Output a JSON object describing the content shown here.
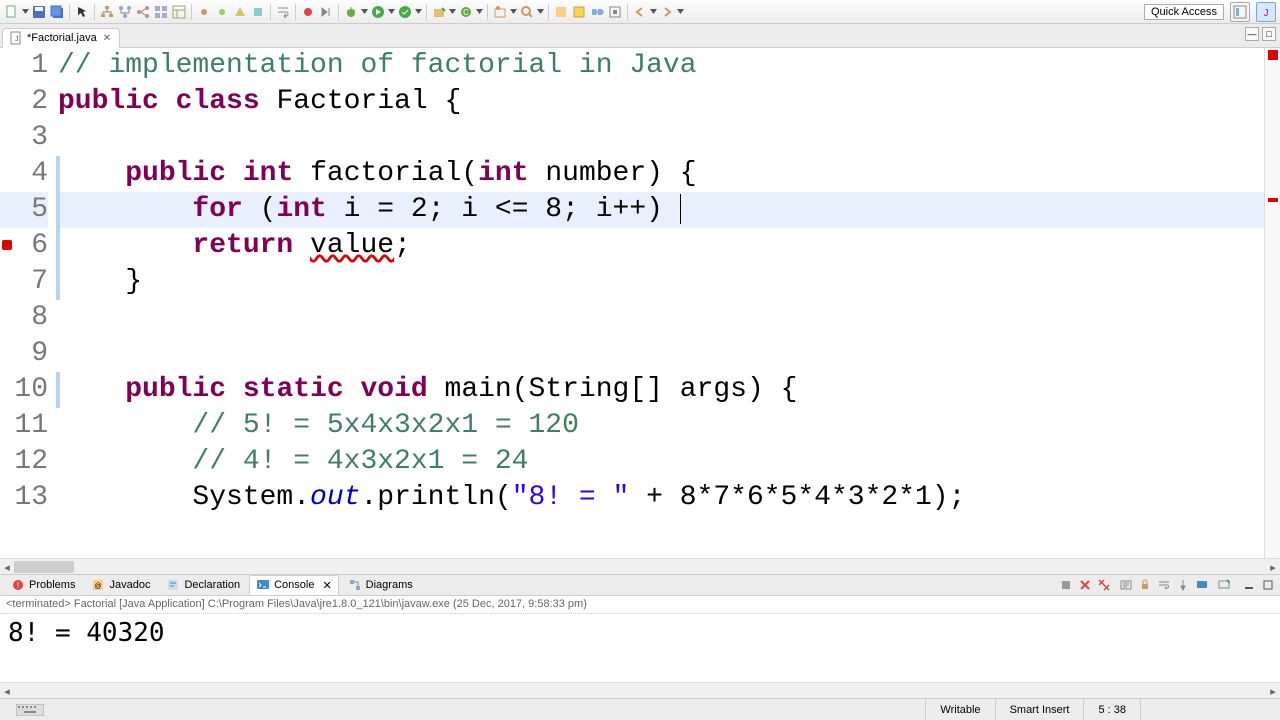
{
  "toolbar": {
    "quick_access": "Quick Access"
  },
  "tab": {
    "filename": "*Factorial.java"
  },
  "code": {
    "lines": [
      {
        "n": "1",
        "indent": 0,
        "tokens": [
          {
            "t": "// implementation of factorial in Java",
            "c": "cm"
          }
        ]
      },
      {
        "n": "2",
        "indent": 0,
        "tokens": [
          {
            "t": "public",
            "c": "kw"
          },
          {
            "t": " "
          },
          {
            "t": "class",
            "c": "kw"
          },
          {
            "t": " Factorial {"
          }
        ]
      },
      {
        "n": "3",
        "indent": 0,
        "tokens": []
      },
      {
        "n": "4",
        "indent": 1,
        "tokens": [
          {
            "t": "public",
            "c": "kw"
          },
          {
            "t": " "
          },
          {
            "t": "int",
            "c": "kw"
          },
          {
            "t": " factorial("
          },
          {
            "t": "int",
            "c": "kw"
          },
          {
            "t": " number) {"
          }
        ]
      },
      {
        "n": "5",
        "indent": 2,
        "active": true,
        "tokens": [
          {
            "t": "for",
            "c": "kw"
          },
          {
            "t": " ("
          },
          {
            "t": "int",
            "c": "kw"
          },
          {
            "t": " i = 2; i <= 8; i++) "
          },
          {
            "t": "",
            "cursor": true
          }
        ]
      },
      {
        "n": "6",
        "indent": 2,
        "err": true,
        "tokens": [
          {
            "t": "return",
            "c": "kw"
          },
          {
            "t": " "
          },
          {
            "t": "value",
            "c": "err-under"
          },
          {
            "t": ";"
          }
        ]
      },
      {
        "n": "7",
        "indent": 1,
        "tokens": [
          {
            "t": "}"
          }
        ]
      },
      {
        "n": "8",
        "indent": 0,
        "tokens": []
      },
      {
        "n": "9",
        "indent": 0,
        "tokens": []
      },
      {
        "n": "10",
        "indent": 1,
        "tokens": [
          {
            "t": "public",
            "c": "kw"
          },
          {
            "t": " "
          },
          {
            "t": "static",
            "c": "kw"
          },
          {
            "t": " "
          },
          {
            "t": "void",
            "c": "kw"
          },
          {
            "t": " main(String[] args) {"
          }
        ]
      },
      {
        "n": "11",
        "indent": 2,
        "tokens": [
          {
            "t": "// 5! = 5x4x3x2x1 = 120",
            "c": "cm"
          }
        ]
      },
      {
        "n": "12",
        "indent": 2,
        "tokens": [
          {
            "t": "// 4! = 4x3x2x1 = 24",
            "c": "cm"
          }
        ]
      },
      {
        "n": "13",
        "indent": 2,
        "tokens": [
          {
            "t": "System."
          },
          {
            "t": "out",
            "c": "fld"
          },
          {
            "t": ".println("
          },
          {
            "t": "\"8! = \"",
            "c": "st"
          },
          {
            "t": " + 8*7*6*5*4*3*2*1);"
          }
        ]
      }
    ],
    "change_bar_rows": [
      4,
      5,
      6,
      7,
      10
    ]
  },
  "views": {
    "tabs": [
      {
        "label": "Problems",
        "icon": "problems"
      },
      {
        "label": "Javadoc",
        "icon": "javadoc"
      },
      {
        "label": "Declaration",
        "icon": "declaration"
      },
      {
        "label": "Console",
        "icon": "console",
        "active": true
      },
      {
        "label": "Diagrams",
        "icon": "diagrams"
      }
    ]
  },
  "console": {
    "meta": "<terminated> Factorial [Java Application] C:\\Program Files\\Java\\jre1.8.0_121\\bin\\javaw.exe (25 Dec, 2017, 9:58:33 pm)",
    "output": "8! = 40320"
  },
  "status": {
    "writable": "Writable",
    "insert": "Smart Insert",
    "pos": "5 : 38"
  }
}
